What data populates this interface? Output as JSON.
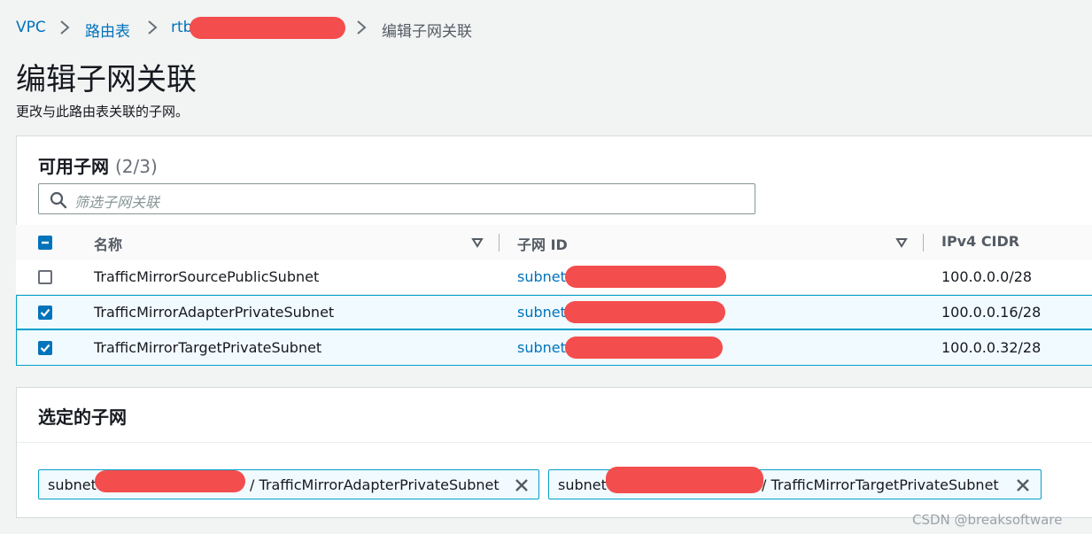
{
  "breadcrumb": {
    "vpc": "VPC",
    "route_tables": "路由表",
    "route_table_prefix": "rtb",
    "current": "编辑子网关联"
  },
  "page": {
    "title": "编辑子网关联",
    "description": "更改与此路由表关联的子网。"
  },
  "available_panel": {
    "title": "可用子网",
    "count": "(2/3)",
    "search_placeholder": "筛选子网关联",
    "columns": {
      "name": "名称",
      "subnet_id": "子网 ID",
      "cidr": "IPv4 CIDR"
    },
    "rows": [
      {
        "name": "TrafficMirrorSourcePublicSubnet",
        "subnet_id_prefix": "subnet",
        "cidr": "100.0.0.0/28",
        "checked": false
      },
      {
        "name": "TrafficMirrorAdapterPrivateSubnet",
        "subnet_id_prefix": "subnet",
        "cidr": "100.0.0.16/28",
        "checked": true
      },
      {
        "name": "TrafficMirrorTargetPrivateSubnet",
        "subnet_id_prefix": "subnet",
        "cidr": "100.0.0.32/28",
        "checked": true
      }
    ]
  },
  "selected_panel": {
    "title": "选定的子网",
    "tokens": [
      {
        "prefix": "subnet",
        "suffix": "/ TrafficMirrorAdapterPrivateSubnet"
      },
      {
        "prefix": "subnet",
        "suffix": "/ TrafficMirrorTargetPrivateSubnet"
      }
    ]
  },
  "watermark": "CSDN @breaksoftware",
  "colors": {
    "link": "#0073bb",
    "selected_border": "#00a1c9",
    "selected_bg": "#f1faff",
    "redaction": "#f44d4d"
  },
  "icons": [
    "search-icon",
    "chevron-right-icon",
    "sort-caret-icon",
    "checkbox-indeterminate-icon",
    "checkbox-checked-icon",
    "close-icon"
  ]
}
